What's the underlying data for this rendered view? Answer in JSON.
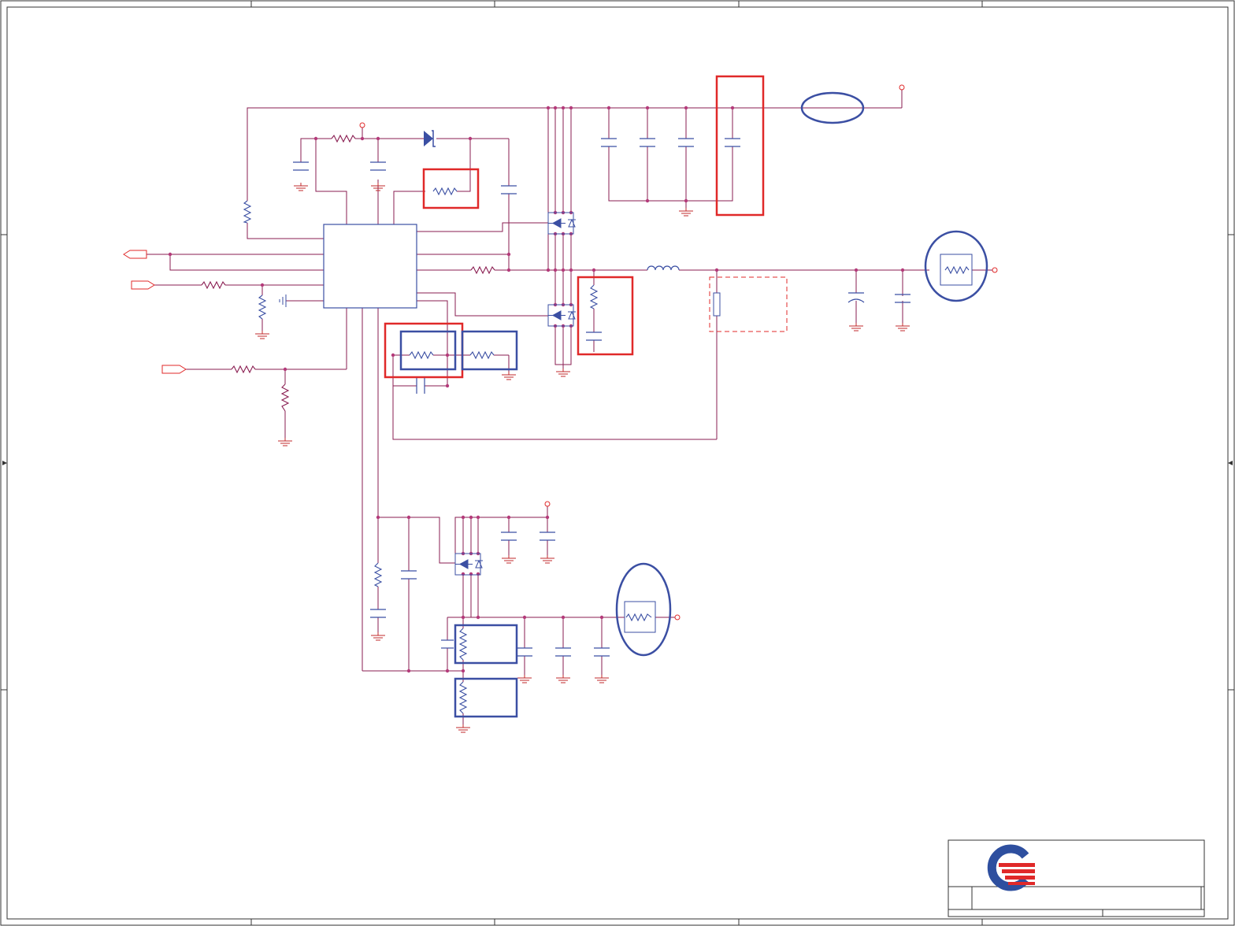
{
  "colors": {
    "wire": "#8a1e52",
    "node": "#b43a7a",
    "component": "#3b4fa3",
    "ground": "#c0282b",
    "highlight_red": "#e02929",
    "highlight_blue": "#3b4fa3",
    "border": "#333333",
    "logo_blue": "#2e4f9f",
    "logo_red": "#e02929"
  },
  "schematic": {
    "controller_ic": "pwm-controller",
    "high_side_fet": "n-channel-mosfet",
    "low_side_fet": "n-channel-mosfet",
    "ldo_fet": "n-channel-mosfet",
    "output_inductor": "inductor",
    "bootstrap_diode": "schottky-diode"
  },
  "title_block": {
    "logo_icon": "company-logo-icon"
  }
}
